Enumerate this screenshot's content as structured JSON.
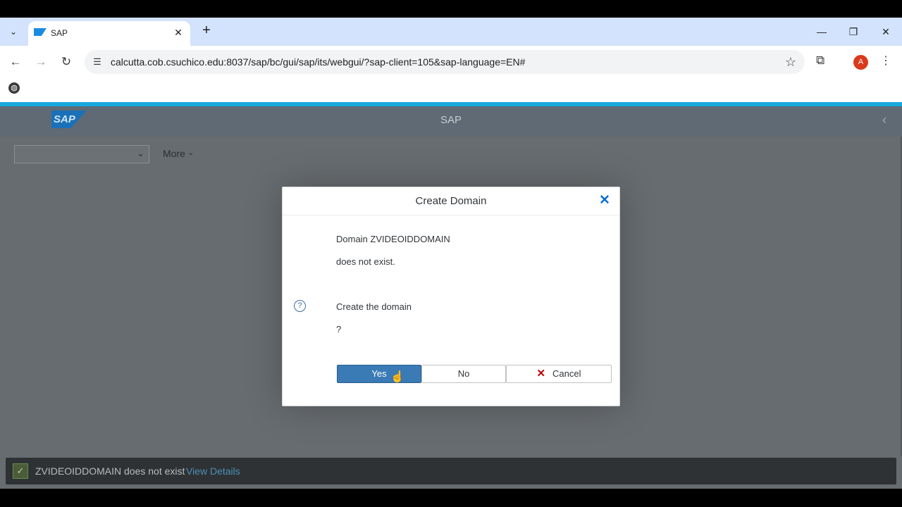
{
  "browser": {
    "tab_title": "SAP",
    "url": "calcutta.cob.csuchico.edu:8037/sap/bc/gui/sap/its/webgui/?sap-client=105&sap-language=EN#",
    "profile_initial": "A"
  },
  "sap": {
    "header_title": "SAP",
    "logo_text": "SAP",
    "more_label": "More",
    "select_value": ""
  },
  "dialog": {
    "title": "Create Domain",
    "line1": "Domain ZVIDEOIDDOMAIN",
    "line2": "does not exist.",
    "line3": "Create the domain",
    "line4": "?",
    "yes_label": "Yes",
    "no_label": "No",
    "cancel_label": "Cancel"
  },
  "status": {
    "message": "ZVIDEOIDDOMAIN does not exist",
    "link": "View Details"
  },
  "icons": {
    "tab_search": "chevron-down-icon",
    "close": "close-icon",
    "new_tab": "plus-icon",
    "back": "back-arrow-icon",
    "forward": "forward-arrow-icon",
    "reload": "reload-icon",
    "site_info": "tune-icon",
    "bookmark": "star-icon",
    "extensions": "puzzle-icon",
    "menu": "kebab-menu-icon",
    "question": "question-icon",
    "status_success": "checkbox-check-icon"
  },
  "colors": {
    "sap_accent": "#16a7de",
    "yes_button": "#3a7ab5",
    "close_blue": "#0a6ed1",
    "cancel_red": "#bb0000",
    "status_link": "#4d8fb5"
  }
}
